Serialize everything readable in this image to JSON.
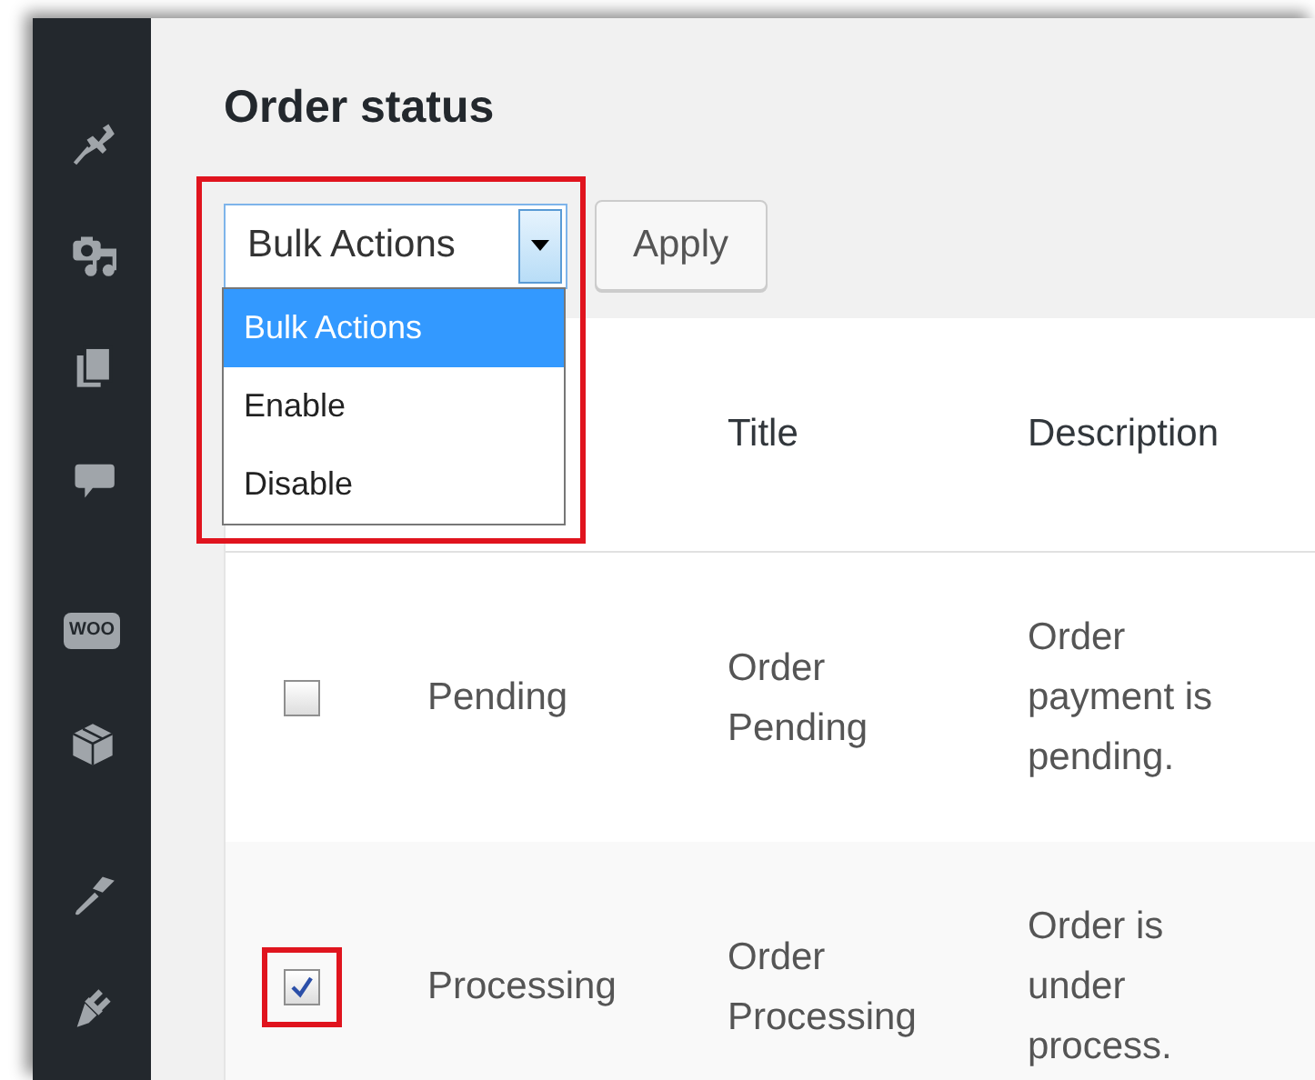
{
  "sidebar": {
    "items": [
      {
        "kind": "pin"
      },
      {
        "kind": "media"
      },
      {
        "kind": "pages"
      },
      {
        "kind": "comment"
      },
      {
        "kind": "woo",
        "text": "WOO"
      },
      {
        "kind": "box"
      },
      {
        "kind": "brush"
      },
      {
        "kind": "plug"
      }
    ]
  },
  "page_title": "Order status",
  "bulk_actions": {
    "value": "Bulk Actions",
    "expanded": true,
    "highlighted": true,
    "options": [
      {
        "label": "Bulk Actions",
        "selected": true
      },
      {
        "label": "Enable",
        "selected": false
      },
      {
        "label": "Disable",
        "selected": false
      }
    ]
  },
  "apply_button": "Apply",
  "table": {
    "headers": {
      "title": "Title",
      "description": "Description"
    },
    "rows": [
      {
        "checked": false,
        "highlighted": false,
        "status": "Pending",
        "title": "Order Pending",
        "description": "Order payment is pending."
      },
      {
        "checked": true,
        "highlighted": true,
        "status": "Processing",
        "title": "Order Processing",
        "description": "Order is under process."
      }
    ]
  }
}
